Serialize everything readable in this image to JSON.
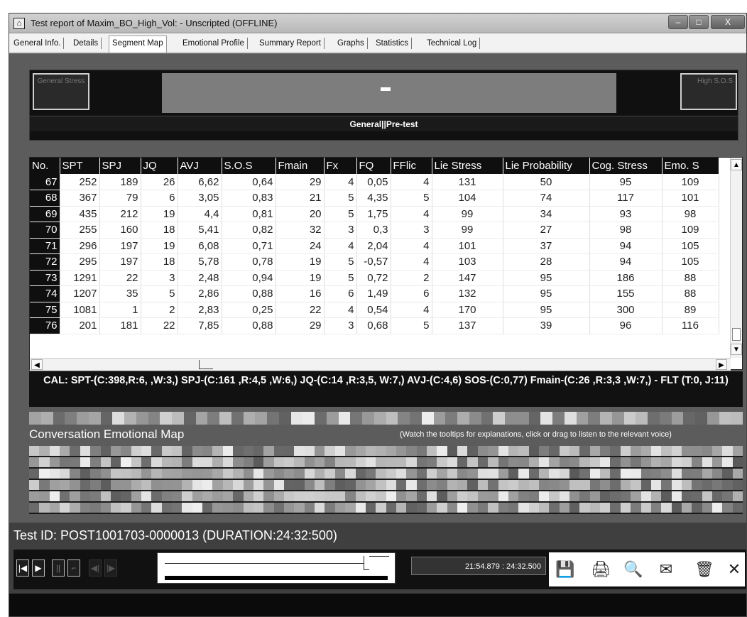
{
  "window": {
    "title": "Test report of Maxim_BO_High_Vol: - Unscripted (OFFLINE)",
    "icon": "app-icon",
    "min_label": "–",
    "max_label": "□",
    "close_label": "X"
  },
  "tabs": [
    {
      "label": "General Info."
    },
    {
      "label": "Details"
    },
    {
      "label": "Segment Map"
    },
    {
      "label": "Emotional Profile"
    },
    {
      "label": "Summary Report"
    },
    {
      "label": "Graphs"
    },
    {
      "label": "Statistics"
    },
    {
      "label": "Technical Log"
    }
  ],
  "active_tab": "Segment Map",
  "stress": {
    "left_label": "General Stress",
    "right_label": "High S.O.S",
    "section_label": "General||Pre-test"
  },
  "grid": {
    "columns": [
      "No.",
      "SPT",
      "SPJ",
      "JQ",
      "AVJ",
      "S.O.S",
      "Fmain",
      "Fx",
      "FQ",
      "FFlic",
      "Lie Stress",
      "Lie Probability",
      "Cog. Stress",
      "Emo. S"
    ],
    "rows": [
      [
        "67",
        "252",
        "189",
        "26",
        "6,62",
        "0,64",
        "29",
        "4",
        "0,05",
        "4",
        "131",
        "50",
        "95",
        "109"
      ],
      [
        "68",
        "367",
        "79",
        "6",
        "3,05",
        "0,83",
        "21",
        "5",
        "4,35",
        "5",
        "104",
        "74",
        "117",
        "101"
      ],
      [
        "69",
        "435",
        "212",
        "19",
        "4,4",
        "0,81",
        "20",
        "5",
        "1,75",
        "4",
        "99",
        "34",
        "93",
        "98"
      ],
      [
        "70",
        "255",
        "160",
        "18",
        "5,41",
        "0,82",
        "32",
        "3",
        "0,3",
        "3",
        "99",
        "27",
        "98",
        "109"
      ],
      [
        "71",
        "296",
        "197",
        "19",
        "6,08",
        "0,71",
        "24",
        "4",
        "2,04",
        "4",
        "101",
        "37",
        "94",
        "105"
      ],
      [
        "72",
        "295",
        "197",
        "18",
        "5,78",
        "0,78",
        "19",
        "5",
        "-0,57",
        "4",
        "103",
        "28",
        "94",
        "105"
      ],
      [
        "73",
        "1291",
        "22",
        "3",
        "2,48",
        "0,94",
        "19",
        "5",
        "0,72",
        "2",
        "147",
        "95",
        "186",
        "88"
      ],
      [
        "74",
        "1207",
        "35",
        "5",
        "2,86",
        "0,88",
        "16",
        "6",
        "1,49",
        "6",
        "132",
        "95",
        "155",
        "88"
      ],
      [
        "75",
        "1081",
        "1",
        "2",
        "2,83",
        "0,25",
        "22",
        "4",
        "0,54",
        "4",
        "170",
        "95",
        "300",
        "89"
      ],
      [
        "76",
        "201",
        "181",
        "22",
        "7,85",
        "0,88",
        "29",
        "3",
        "0,68",
        "5",
        "137",
        "39",
        "96",
        "116"
      ]
    ]
  },
  "calibration": "CAL: SPT-(C:398,R:6, ,W:3,) SPJ-(C:161 ,R:4,5 ,W:6,) JQ-(C:14 ,R:3,5, W:7,) AVJ-(C:4,6) SOS-(C:0,77) Fmain-(C:26 ,R:3,3 ,W:7,) - FLT (T:0, J:11)",
  "emotional_map": {
    "title": "Conversation Emotional Map",
    "hint": "(Watch the tooltips for explanations, click or drag to listen to the relevant voice)"
  },
  "status": {
    "test_id": "Test ID: POST1001703-0000013 (DURATION:24:32:500)",
    "time": "21:54.879 : 24:32.500"
  },
  "player_buttons": {
    "start": "|◀",
    "play": "▶",
    "pause": "||",
    "stop": "⌐",
    "prev": "◀|",
    "next": "|▶"
  },
  "tools": {
    "save": "💾",
    "print": "🖨",
    "preview": "🔍",
    "email": "✉",
    "delete": "🗑",
    "close": "✕"
  },
  "colors": {
    "header_black": "#0f0f0f",
    "panel_gray": "#5c5c5c"
  }
}
